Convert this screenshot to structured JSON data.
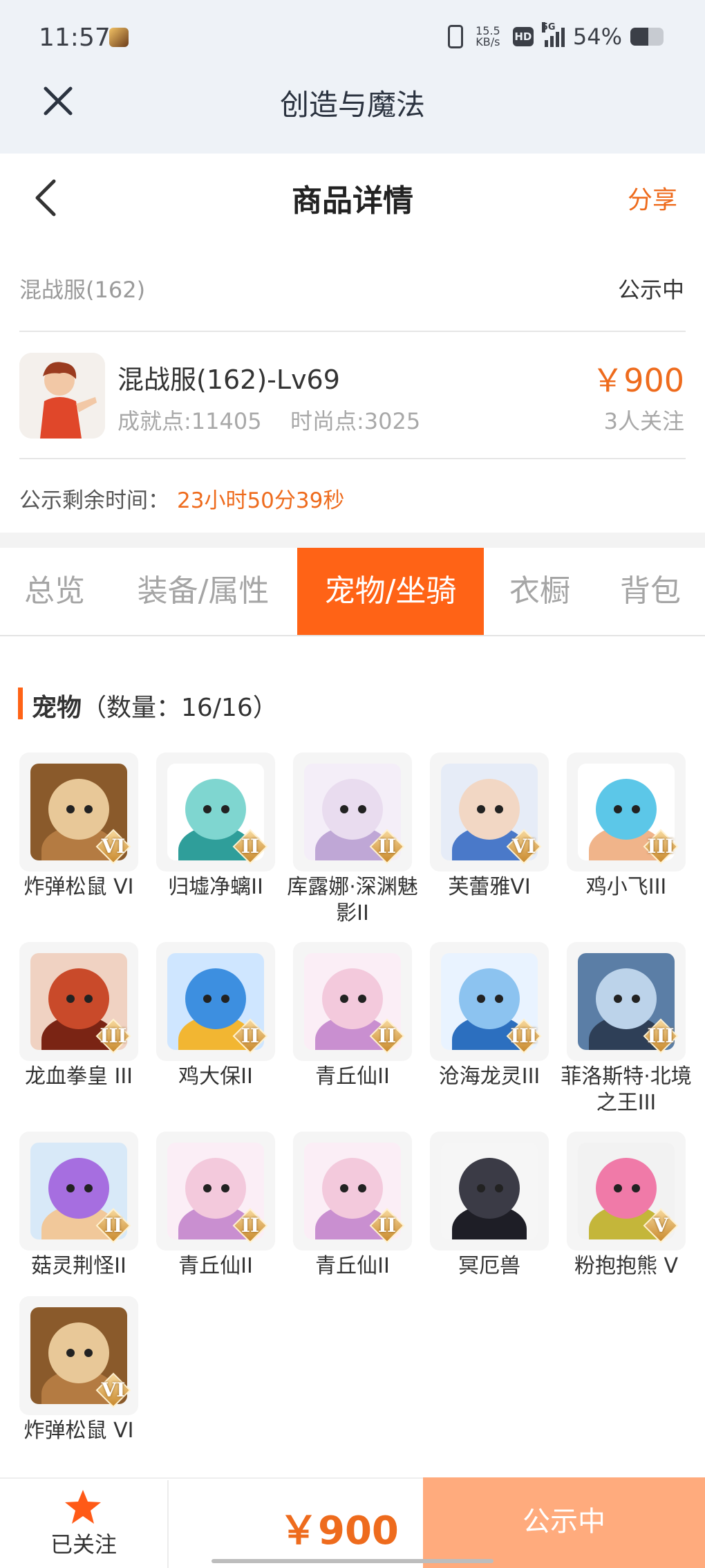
{
  "status_bar": {
    "time": "11:57",
    "net_speed_value": "15.5",
    "net_speed_unit": "KB/s",
    "hd": "HD",
    "network": "5G",
    "battery": "54%",
    "battery_level": 0.54
  },
  "app_header": {
    "title": "创造与魔法"
  },
  "page_header": {
    "title": "商品详情",
    "share": "分享"
  },
  "listing": {
    "server": "混战服(162)",
    "status": "公示中",
    "character_name": "混战服(162)-Lv69",
    "achievement_points": "成就点:11405",
    "fashion_points": "时尚点:3025",
    "price": "￥900",
    "followers": "3人关注",
    "remaining_label": "公示剩余时间：",
    "remaining_value": "23小时50分39秒"
  },
  "tabs": [
    {
      "label": "总览",
      "active": false
    },
    {
      "label": "装备/属性",
      "active": false
    },
    {
      "label": "宠物/坐骑",
      "active": true
    },
    {
      "label": "衣橱",
      "active": false
    },
    {
      "label": "背包",
      "active": false
    }
  ],
  "pets_section": {
    "title": "宠物",
    "count": "（数量：16/16）"
  },
  "pets": [
    {
      "name": "炸弹松鼠 VI",
      "grade": "VI",
      "colors": [
        "#8a5a2b",
        "#e8c898",
        "#b47b42"
      ]
    },
    {
      "name": "归墟净螭II",
      "grade": "II",
      "colors": [
        "#ffffff",
        "#7fd6d0",
        "#2f9e9a"
      ]
    },
    {
      "name": "库露娜·深渊魅影II",
      "grade": "II",
      "colors": [
        "#f4eef8",
        "#e9dcef",
        "#bfa7d6"
      ]
    },
    {
      "name": "芙蕾雅VI",
      "grade": "VI",
      "colors": [
        "#e6ecf7",
        "#f2d7c4",
        "#4a79c9"
      ]
    },
    {
      "name": "鸡小飞III",
      "grade": "III",
      "colors": [
        "#ffffff",
        "#5cc7e8",
        "#f0b48a"
      ]
    },
    {
      "name": "龙血拳皇 III",
      "grade": "III",
      "colors": [
        "#f0d2c2",
        "#c94a2a",
        "#7a2414"
      ]
    },
    {
      "name": "鸡大保II",
      "grade": "II",
      "colors": [
        "#cfe6ff",
        "#3d8fe0",
        "#f2b632"
      ]
    },
    {
      "name": "青丘仙II",
      "grade": "II",
      "colors": [
        "#fbeef6",
        "#f3c9dc",
        "#c98fd0"
      ]
    },
    {
      "name": "沧海龙灵III",
      "grade": "III",
      "colors": [
        "#e9f3ff",
        "#8cc3f0",
        "#2c6fbf"
      ]
    },
    {
      "name": "菲洛斯特·北境之王III",
      "grade": "III",
      "colors": [
        "#5b7ea6",
        "#bcd3ea",
        "#2e3f57"
      ]
    },
    {
      "name": "菇灵荆怪II",
      "grade": "II",
      "colors": [
        "#d8e9f8",
        "#a66ee0",
        "#f1c89a"
      ]
    },
    {
      "name": "青丘仙II",
      "grade": "II",
      "colors": [
        "#fbeef6",
        "#f3c9dc",
        "#c98fd0"
      ]
    },
    {
      "name": "青丘仙II",
      "grade": "II",
      "colors": [
        "#fbeef6",
        "#f3c9dc",
        "#c98fd0"
      ]
    },
    {
      "name": "冥厄兽",
      "grade": "",
      "colors": [
        "#f6f6f6",
        "#3b3b46",
        "#1e1e26"
      ]
    },
    {
      "name": "粉抱抱熊 V",
      "grade": "V",
      "colors": [
        "#f2f2f2",
        "#f07aa8",
        "#c4b63a"
      ]
    },
    {
      "name": "炸弹松鼠 VI",
      "grade": "VI",
      "colors": [
        "#8a5a2b",
        "#e8c898",
        "#b47b42"
      ]
    }
  ],
  "bottom_bar": {
    "follow_label": "已关注",
    "price": "￥900",
    "status_button": "公示中"
  },
  "colors": {
    "accent": "#ff6316",
    "price": "#ee6b1d",
    "status_button": "#ffab7d"
  },
  "icons": [
    "close-icon",
    "back-icon",
    "star-icon"
  ]
}
